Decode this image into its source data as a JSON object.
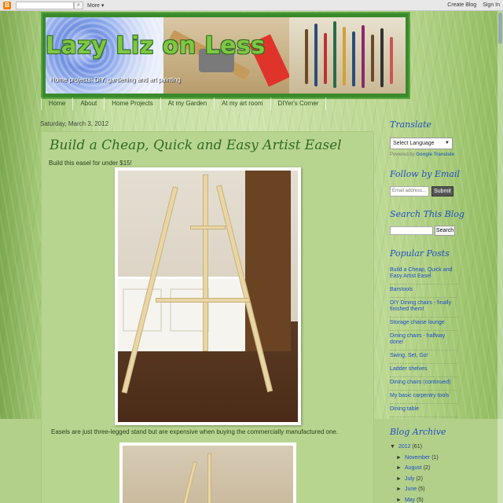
{
  "navbar": {
    "logo": "B",
    "search_button": "",
    "more": "More ▾",
    "create_blog": "Create Blog",
    "sign_in": "Sign In"
  },
  "header": {
    "title": "Lazy Liz on Less",
    "description": "Home projects: DIY, gardening and art painting"
  },
  "tabs": [
    "Home",
    "About",
    "Home Projects",
    "At my Garden",
    "At my art room",
    "DIYer's Corner"
  ],
  "post": {
    "date": "Saturday, March 3, 2012",
    "title": "Build a Cheap, Quick and Easy Artist Easel",
    "intro": "Build this easel for under $15!",
    "paragraph": "Easels are just three-legged stand but are expensive when buying the commercially manufactured one."
  },
  "sidebar": {
    "translate": {
      "title": "Translate",
      "select_label": "Select Language",
      "powered_by": "Powered by",
      "google": "Google",
      "translate_link": "Translate"
    },
    "follow": {
      "title": "Follow by Email",
      "placeholder": "Email address...",
      "submit": "Submit"
    },
    "search": {
      "title": "Search This Blog",
      "button": "Search"
    },
    "popular": {
      "title": "Popular Posts",
      "items": [
        "Build a Cheap, Quick and Easy Artist Easel",
        "Barstools",
        "DIY Dining chairs - finally finished them!",
        "Storage chaise lounge",
        "Dining chairs - halfway done!",
        "Swing, Set, Go!",
        "Ladder shelves",
        "Dining chairs (continued)",
        "My basic carpentry tools",
        "Dining table"
      ]
    },
    "archive": {
      "title": "Blog Archive",
      "year": {
        "label": "2012",
        "count": "(61)"
      },
      "months": [
        {
          "label": "November",
          "count": "(1)"
        },
        {
          "label": "August",
          "count": "(2)"
        },
        {
          "label": "July",
          "count": "(2)"
        },
        {
          "label": "June",
          "count": "(5)"
        },
        {
          "label": "May",
          "count": "(5)"
        }
      ]
    }
  },
  "colors": {
    "title_green": "#7fc744",
    "widget_title_blue": "#2050c0",
    "link_blue": "#1d4fc5",
    "header_border": "#3a8a2c"
  }
}
